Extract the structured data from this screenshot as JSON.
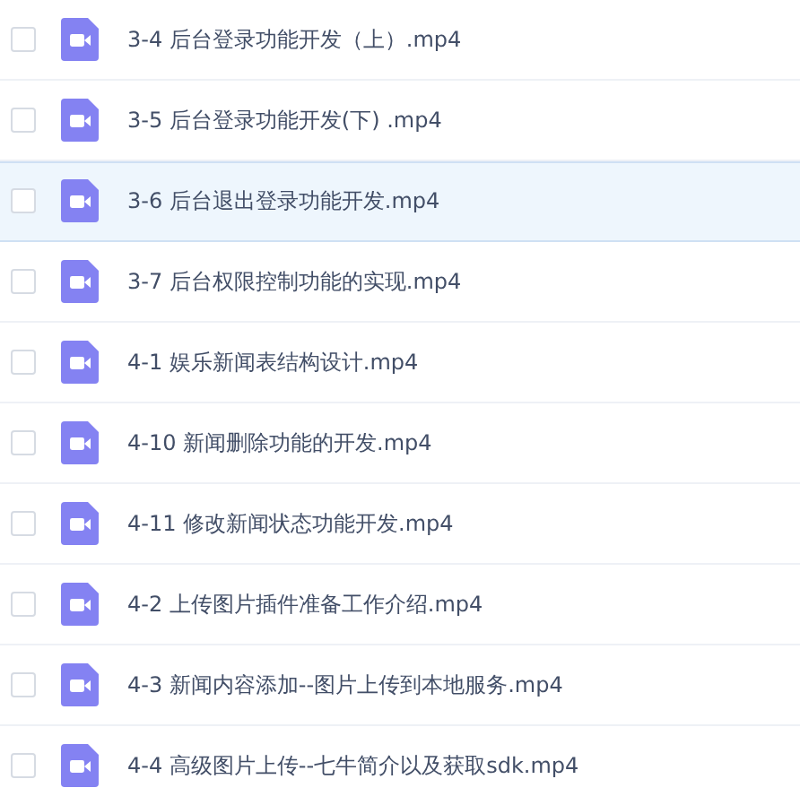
{
  "files": [
    {
      "name": "3-4 后台登录功能开发（上）.mp4",
      "selected": false,
      "checked": false
    },
    {
      "name": "3-5 后台登录功能开发(下) .mp4",
      "selected": false,
      "checked": false
    },
    {
      "name": "3-6 后台退出登录功能开发.mp4",
      "selected": true,
      "checked": false
    },
    {
      "name": "3-7 后台权限控制功能的实现.mp4",
      "selected": false,
      "checked": false
    },
    {
      "name": "4-1 娱乐新闻表结构设计.mp4",
      "selected": false,
      "checked": false
    },
    {
      "name": "4-10 新闻删除功能的开发.mp4",
      "selected": false,
      "checked": false
    },
    {
      "name": "4-11 修改新闻状态功能开发.mp4",
      "selected": false,
      "checked": false
    },
    {
      "name": "4-2 上传图片插件准备工作介绍.mp4",
      "selected": false,
      "checked": false
    },
    {
      "name": "4-3 新闻内容添加--图片上传到本地服务.mp4",
      "selected": false,
      "checked": false
    },
    {
      "name": "4-4 高级图片上传--七牛简介以及获取sdk.mp4",
      "selected": false,
      "checked": false
    }
  ]
}
